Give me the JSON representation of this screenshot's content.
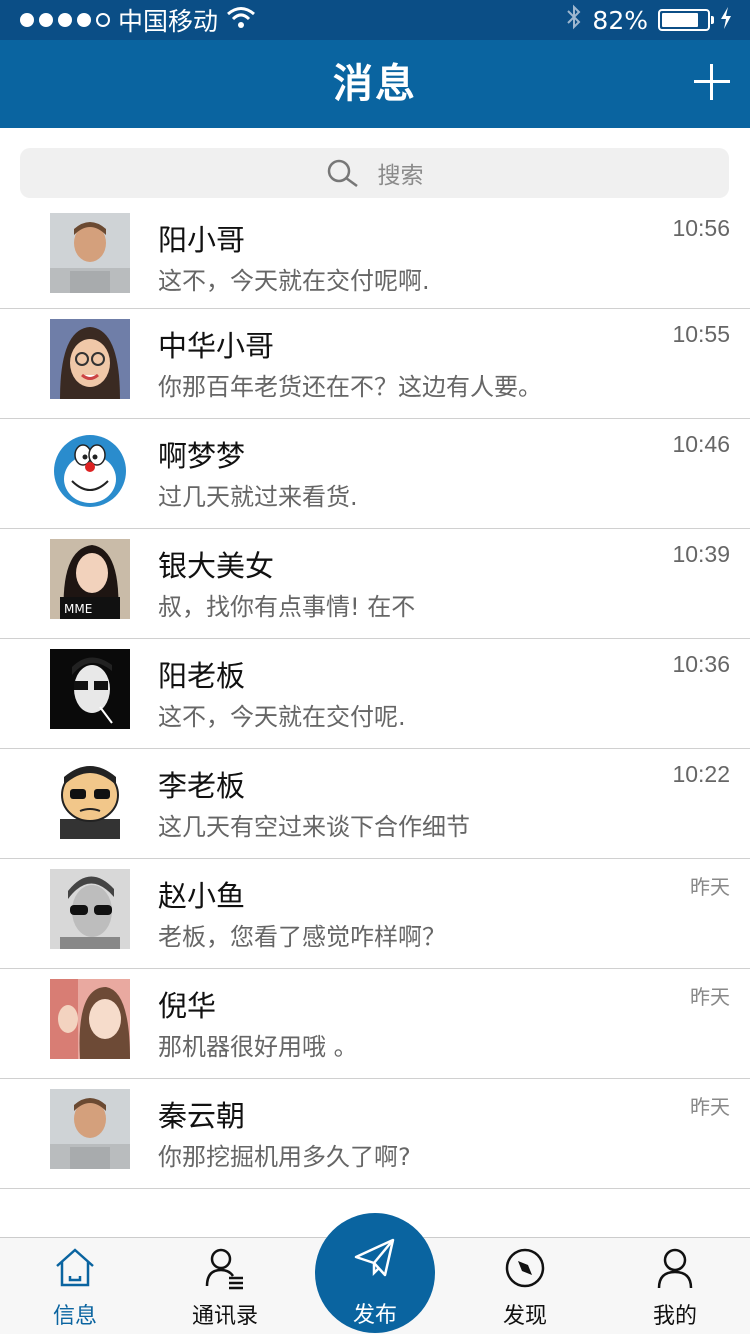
{
  "status_bar": {
    "carrier": "中国移动",
    "battery": "82%",
    "signal_bars_filled": 4,
    "battery_level": 0.82
  },
  "header": {
    "title": "消息"
  },
  "search": {
    "placeholder": "搜索"
  },
  "messages": [
    {
      "name": "阳小哥",
      "preview": "这不，今天就在交付呢啊.",
      "time": "10:56"
    },
    {
      "name": "中华小哥",
      "preview": "你那百年老货还在不？这边有人要。",
      "time": "10:55"
    },
    {
      "name": "啊梦梦",
      "preview": "过几天就过来看货.",
      "time": "10:46"
    },
    {
      "name": "银大美女",
      "preview": "叔，找你有点事情! 在不",
      "time": "10:39"
    },
    {
      "name": "阳老板",
      "preview": "这不，今天就在交付呢.",
      "time": "10:36"
    },
    {
      "name": "李老板",
      "preview": "这几天有空过来谈下合作细节",
      "time": "10:22"
    },
    {
      "name": "赵小鱼",
      "preview": "老板，您看了感觉咋样啊？",
      "time": "昨天"
    },
    {
      "name": "倪华",
      "preview": "那机器很好用哦 。",
      "time": "昨天"
    },
    {
      "name": "秦云朝",
      "preview": "你那挖掘机用多久了啊?",
      "time": "昨天"
    }
  ],
  "tabbar": {
    "messages": "信息",
    "contacts": "通讯录",
    "publish": "发布",
    "discover": "发现",
    "mine": "我的"
  },
  "colors": {
    "status_bar": "#0b4e86",
    "header": "#0a64a0",
    "accent": "#0a64a0",
    "search_bg": "#f0f0f0"
  }
}
